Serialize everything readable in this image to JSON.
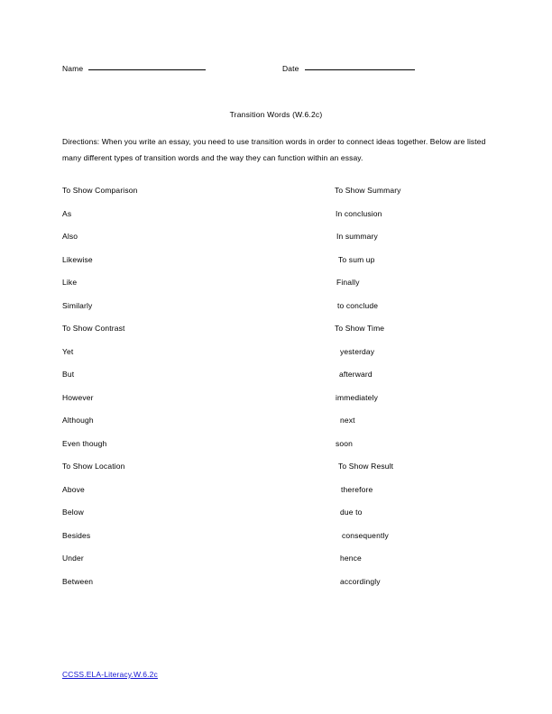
{
  "header": {
    "name_label": "Name",
    "date_label": "Date"
  },
  "title": "Transition Words (W.6.2c)",
  "directions": "Directions: When you write an essay, you need to use transition words in order to connect ideas together. Below are listed many different types of transition words and the way they can function within an essay.",
  "columns": {
    "left": [
      {
        "text": "To Show Comparison",
        "heading": true,
        "indent": 0
      },
      {
        "text": "As",
        "heading": false,
        "indent": 0
      },
      {
        "text": "Also",
        "heading": false,
        "indent": 0
      },
      {
        "text": "Likewise",
        "heading": false,
        "indent": 0
      },
      {
        "text": "Like",
        "heading": false,
        "indent": 0
      },
      {
        "text": "Similarly",
        "heading": false,
        "indent": 0
      },
      {
        "text": "To Show Contrast",
        "heading": true,
        "indent": 0
      },
      {
        "text": "Yet",
        "heading": false,
        "indent": 0
      },
      {
        "text": "But",
        "heading": false,
        "indent": 0
      },
      {
        "text": "However",
        "heading": false,
        "indent": 0
      },
      {
        "text": "Although",
        "heading": false,
        "indent": 0
      },
      {
        "text": "Even though",
        "heading": false,
        "indent": 0
      },
      {
        "text": "To Show Location",
        "heading": true,
        "indent": 0
      },
      {
        "text": "Above",
        "heading": false,
        "indent": 0
      },
      {
        "text": "Below",
        "heading": false,
        "indent": 0
      },
      {
        "text": "Besides",
        "heading": false,
        "indent": 0
      },
      {
        "text": "Under",
        "heading": false,
        "indent": 0
      },
      {
        "text": "Between",
        "heading": false,
        "indent": 0
      }
    ],
    "right": [
      {
        "text": "To Show Summary",
        "heading": true,
        "indent": 0
      },
      {
        "text": "In conclusion",
        "heading": false,
        "indent": 1
      },
      {
        "text": "In summary",
        "heading": false,
        "indent": 2
      },
      {
        "text": "To sum up",
        "heading": false,
        "indent": 4
      },
      {
        "text": "Finally",
        "heading": false,
        "indent": 2
      },
      {
        "text": "to conclude",
        "heading": false,
        "indent": 3
      },
      {
        "text": "To Show Time",
        "heading": true,
        "indent": 0
      },
      {
        "text": "yesterday",
        "heading": false,
        "indent": 6
      },
      {
        "text": "afterward",
        "heading": false,
        "indent": 5
      },
      {
        "text": "immediately",
        "heading": false,
        "indent": 1
      },
      {
        "text": "next",
        "heading": false,
        "indent": 6
      },
      {
        "text": "soon",
        "heading": false,
        "indent": 1
      },
      {
        "text": "To Show Result",
        "heading": true,
        "indent": 4
      },
      {
        "text": "therefore",
        "heading": false,
        "indent": 7
      },
      {
        "text": "due to",
        "heading": false,
        "indent": 6
      },
      {
        "text": "consequently",
        "heading": false,
        "indent": 8
      },
      {
        "text": "hence",
        "heading": false,
        "indent": 6
      },
      {
        "text": "accordingly",
        "heading": false,
        "indent": 6
      }
    ]
  },
  "footer": {
    "standard_link": "CCSS.ELA-Literacy.W.6.2c",
    "link_color": "#1414d2"
  }
}
